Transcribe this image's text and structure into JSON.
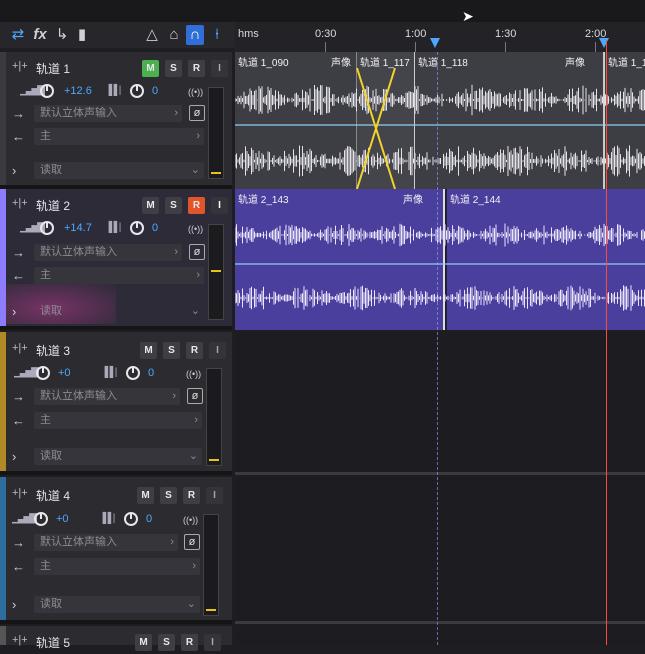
{
  "toolbar": {
    "icons": [
      "swap-icon",
      "fx-icon",
      "send-icon",
      "bars-icon",
      "metronome-icon",
      "punch-icon",
      "loop-icon",
      "marker-icon"
    ],
    "labels": {
      "fx": "fx"
    }
  },
  "ruler": {
    "unit": "hms",
    "ticks": [
      "0:30",
      "1:00",
      "1:30",
      "2:00"
    ]
  },
  "tracks": [
    {
      "name": "轨道 1",
      "strip_color": "#3a3a40",
      "volume": "+12.6",
      "pan": "0",
      "input": "默认立体声输入",
      "output": "主",
      "automation": "读取",
      "m_on": true,
      "r_on": false,
      "clips": [
        {
          "title": "轨道 1_090",
          "tag": "声像"
        },
        {
          "title": "轨道 1_117",
          "tag": ""
        },
        {
          "title": "轨道 1_118",
          "tag": "声像"
        },
        {
          "title": "轨道 1_1",
          "tag": ""
        }
      ]
    },
    {
      "name": "轨道 2",
      "strip_color": "#8e7cff",
      "volume": "+14.7",
      "pan": "0",
      "input": "默认立体声输入",
      "output": "主",
      "automation": "读取",
      "m_on": false,
      "r_on": true,
      "clips": [
        {
          "title": "轨道 2_143",
          "tag": "声像"
        },
        {
          "title": "轨道 2_144",
          "tag": ""
        }
      ]
    },
    {
      "name": "轨道 3",
      "strip_color": "#b08a25",
      "volume": "+0",
      "pan": "0",
      "input": "默认立体声输入",
      "output": "主",
      "automation": "读取",
      "m_on": false,
      "r_on": false
    },
    {
      "name": "轨道 4",
      "strip_color": "#2c6f9e",
      "volume": "+0",
      "pan": "0",
      "input": "默认立体声输入",
      "output": "主",
      "automation": "读取",
      "m_on": false,
      "r_on": false
    },
    {
      "name": "轨道 5",
      "strip_color": "#555",
      "m_on": false,
      "r_on": false
    }
  ],
  "buttons": {
    "m": "M",
    "s": "S",
    "r": "R",
    "i": "I"
  },
  "colors": {
    "track1_clip": "#3d3d44",
    "track2_clip": "#4a3f9c",
    "playhead": "#ff4a3a",
    "accent": "#4ea8ff"
  }
}
